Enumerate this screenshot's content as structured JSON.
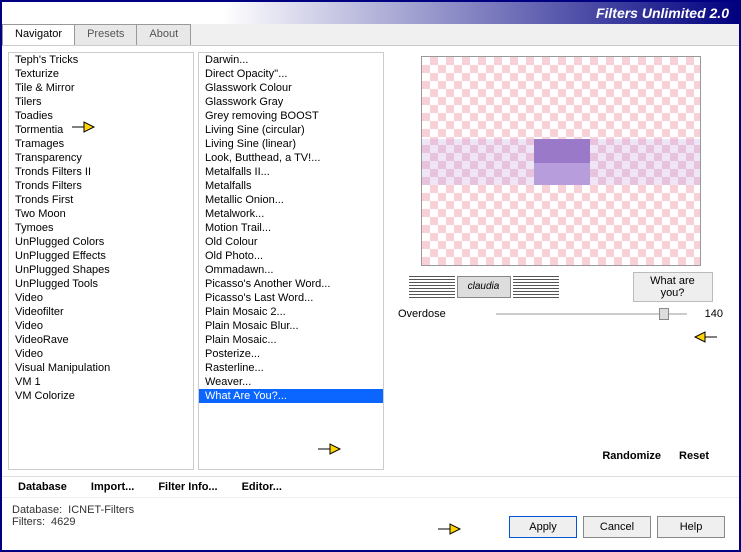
{
  "title": "Filters Unlimited 2.0",
  "tabs": [
    "Navigator",
    "Presets",
    "About"
  ],
  "left_list": [
    "Teph's Tricks",
    "Texturize",
    "Tile & Mirror",
    "Tilers",
    "Toadies",
    "Tormentia",
    "Tramages",
    "Transparency",
    "Tronds Filters II",
    "Tronds Filters",
    "Tronds First",
    "Two Moon",
    "Tymoes",
    "UnPlugged Colors",
    "UnPlugged Effects",
    "UnPlugged Shapes",
    "UnPlugged Tools",
    "Video",
    "Videofilter",
    "Video",
    "VideoRave",
    "Video",
    "Visual Manipulation",
    "VM 1",
    "VM Colorize"
  ],
  "right_list": [
    "Darwin...",
    "Direct Opacity''...",
    "Glasswork Colour",
    "Glasswork Gray",
    "Grey removing BOOST",
    "Living Sine (circular)",
    "Living Sine (linear)",
    "Look, Butthead, a TV!...",
    "Metalfalls II...",
    "Metalfalls",
    "Metallic Onion...",
    "Metalwork...",
    "Motion Trail...",
    "Old Colour",
    "Old Photo...",
    "Ommadawn...",
    "Picasso's Another Word...",
    "Picasso's Last Word...",
    "Plain Mosaic 2...",
    "Plain Mosaic Blur...",
    "Plain Mosaic...",
    "Posterize...",
    "Rasterline...",
    "Weaver...",
    "What Are You?..."
  ],
  "selected_filter": "What Are You?...",
  "watermark": "claudia",
  "param_title": "What are you?",
  "slider": {
    "label": "Overdose",
    "value": "140"
  },
  "right_buttons": {
    "randomize": "Randomize",
    "reset": "Reset"
  },
  "mid_buttons": {
    "database": "Database",
    "import": "Import...",
    "filterinfo": "Filter Info...",
    "editor": "Editor..."
  },
  "status": {
    "db_label": "Database:",
    "db_value": "ICNET-Filters",
    "filters_label": "Filters:",
    "filters_value": "4629"
  },
  "dlg": {
    "apply": "Apply",
    "cancel": "Cancel",
    "help": "Help"
  }
}
